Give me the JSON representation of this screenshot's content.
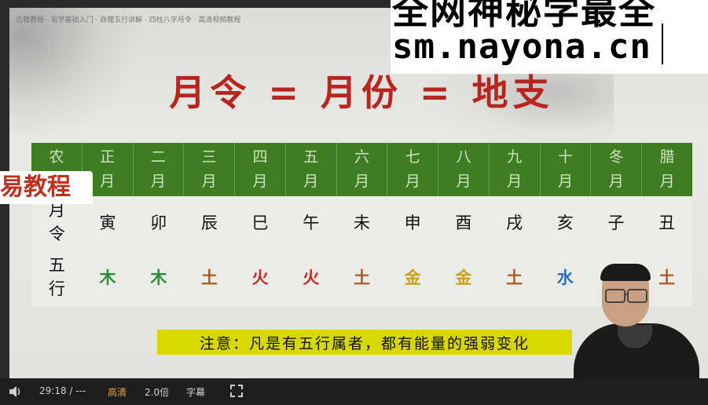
{
  "watermark": {
    "line1": "全网神秘学最全",
    "line2": "sm.nayona.cn"
  },
  "top_caption": "古籍教程 · 易学基础入门 · 命理五行讲解 · 四柱八字月令 · 高清视频教程",
  "side_label": "易教程",
  "slide": {
    "title": "月令 = 月份 = 地支",
    "table": {
      "header_label": [
        "农",
        "月"
      ],
      "months": [
        [
          "正",
          "月"
        ],
        [
          "二",
          "月"
        ],
        [
          "三",
          "月"
        ],
        [
          "四",
          "月"
        ],
        [
          "五",
          "月"
        ],
        [
          "六",
          "月"
        ],
        [
          "七",
          "月"
        ],
        [
          "八",
          "月"
        ],
        [
          "九",
          "月"
        ],
        [
          "十",
          "月"
        ],
        [
          "冬",
          "月"
        ],
        [
          "腊",
          "月"
        ]
      ],
      "row1_label": [
        "月",
        "令"
      ],
      "branches": [
        "寅",
        "卯",
        "辰",
        "巳",
        "午",
        "未",
        "申",
        "酉",
        "戌",
        "亥",
        "子",
        "丑"
      ],
      "row2_label": [
        "五",
        "行"
      ],
      "elements": [
        {
          "text": "木",
          "color": "#2e8b3a"
        },
        {
          "text": "木",
          "color": "#2e8b3a"
        },
        {
          "text": "土",
          "color": "#b5541c"
        },
        {
          "text": "火",
          "color": "#c9281f"
        },
        {
          "text": "火",
          "color": "#c9281f"
        },
        {
          "text": "土",
          "color": "#b5541c"
        },
        {
          "text": "金",
          "color": "#c9a11a"
        },
        {
          "text": "金",
          "color": "#c9a11a"
        },
        {
          "text": "土",
          "color": "#b5541c"
        },
        {
          "text": "水",
          "color": "#2a6fbd"
        },
        {
          "text": "",
          "color": "#2a6fbd"
        },
        {
          "text": "土",
          "color": "#b5541c"
        }
      ]
    },
    "note": "注意：凡是有五行属者，都有能量的强弱变化"
  },
  "controls": {
    "volume_icon": "volume-icon",
    "time": "29:18 / ---",
    "quality": "高清",
    "speed": "2.0倍",
    "subtitle": "字幕",
    "fullscreen_icon": "fullscreen-icon"
  },
  "colors": {
    "title_red": "#b8251f",
    "header_green": "#3f7d23",
    "note_yellow": "#d9d700",
    "quality_orange": "#e6a23c"
  }
}
